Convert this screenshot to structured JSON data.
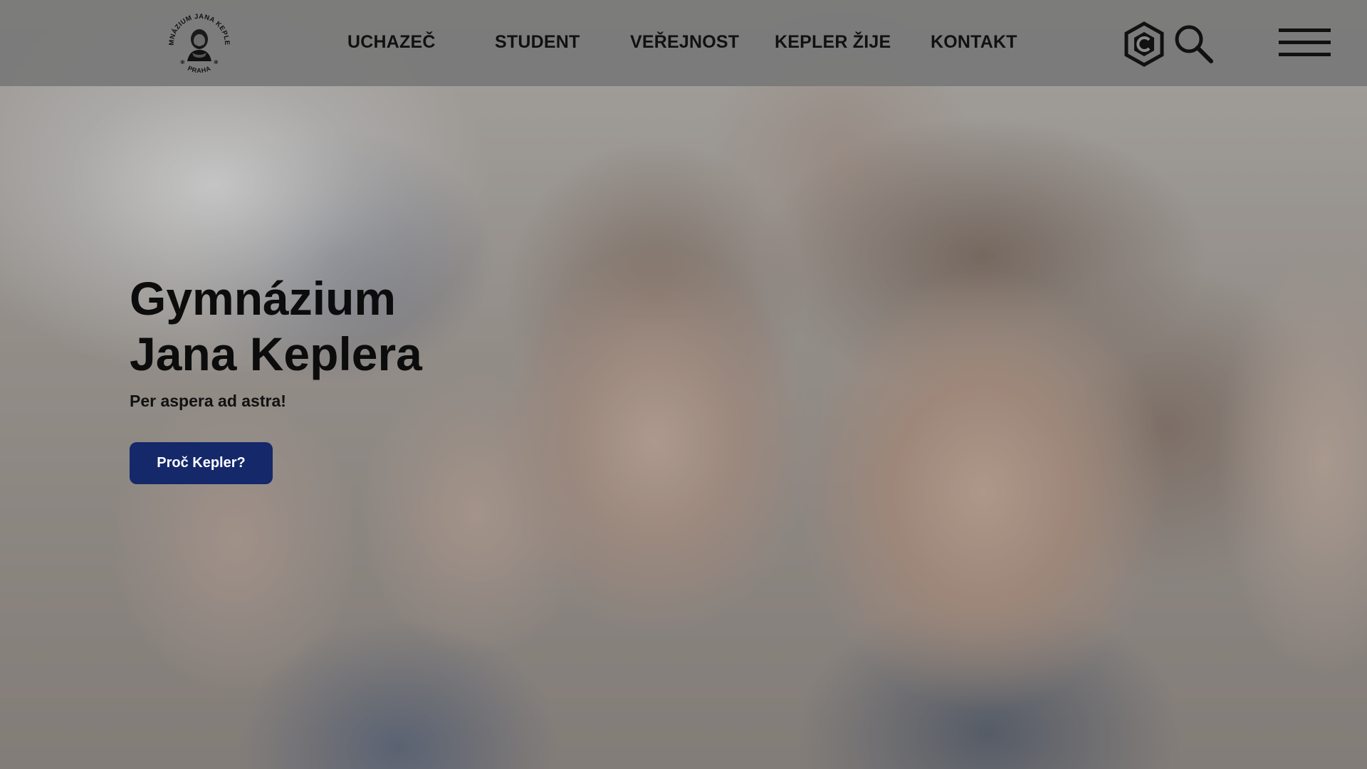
{
  "header": {
    "logo": {
      "icon": "school-seal-logo",
      "seal_text_top": "GYMNÁZIUM JANA KEPLERA",
      "seal_text_bottom": "PRAHA"
    },
    "nav": [
      {
        "label": "UCHAZEČ"
      },
      {
        "label": "STUDENT"
      },
      {
        "label": "VEŘEJNOST"
      },
      {
        "label": "KEPLER ŽIJE"
      },
      {
        "label": "KONTAKT"
      }
    ],
    "icons": [
      "hexagon-logo-icon",
      "search-icon",
      "hamburger-menu-icon"
    ]
  },
  "hero": {
    "title_line1": "Gymnázium",
    "title_line2": "Jana Keplera",
    "tagline": "Per aspera ad astra!",
    "cta_label": "Proč Kepler?",
    "background": "photo of students"
  },
  "colors": {
    "header_bg": "#787878",
    "nav_text": "#111111",
    "cta_bg": "#14286a",
    "cta_text": "#ffffff",
    "title_text": "#0c0c0c"
  }
}
